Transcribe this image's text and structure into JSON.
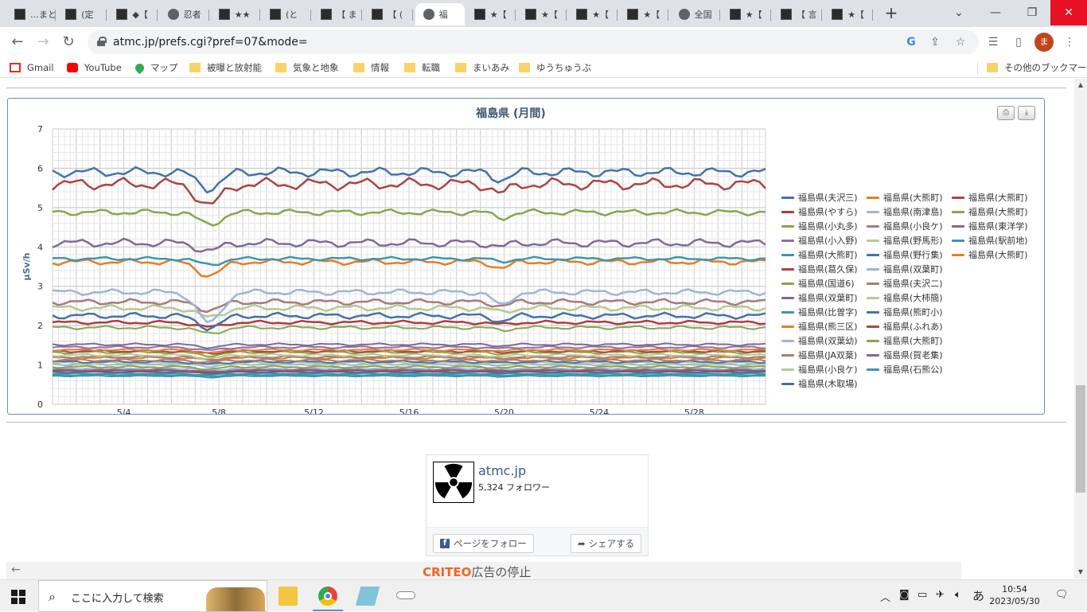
{
  "browser": {
    "tabs": [
      {
        "label": "…まと",
        "icon": "dark"
      },
      {
        "label": "(定",
        "icon": "dark"
      },
      {
        "label": "◆【",
        "icon": "dark"
      },
      {
        "label": "忍者",
        "icon": "globe"
      },
      {
        "label": "★★",
        "icon": "dark"
      },
      {
        "label": "(と",
        "icon": "dark"
      },
      {
        "label": "【 ま",
        "icon": "dark"
      },
      {
        "label": "【 (",
        "icon": "dark"
      },
      {
        "label": "福",
        "icon": "globe",
        "active": true
      },
      {
        "label": "★【",
        "icon": "dark"
      },
      {
        "label": "★【",
        "icon": "dark"
      },
      {
        "label": "★【",
        "icon": "dark"
      },
      {
        "label": "★【",
        "icon": "dark"
      },
      {
        "label": "全国",
        "icon": "globe"
      },
      {
        "label": "★【",
        "icon": "dark"
      },
      {
        "label": "【 言",
        "icon": "dark"
      },
      {
        "label": "★【",
        "icon": "dark"
      }
    ],
    "url": "atmc.jp/prefs.cgi?pref=07&mode=",
    "profile_initial": "ま",
    "bookmarks": [
      {
        "label": "Gmail",
        "icon": "gmail"
      },
      {
        "label": "YouTube",
        "icon": "yt"
      },
      {
        "label": "マップ",
        "icon": "maps"
      },
      {
        "label": "被曝と放射能",
        "icon": "folder"
      },
      {
        "label": "気象と地象",
        "icon": "folder"
      },
      {
        "label": "情報",
        "icon": "folder"
      },
      {
        "label": "転職",
        "icon": "folder"
      },
      {
        "label": "まいあみ",
        "icon": "folder"
      },
      {
        "label": "ゆうちゅうぶ",
        "icon": "folder"
      }
    ],
    "other_bookmarks": "その他のブックマーク"
  },
  "chart": {
    "title": "福島県 (月間)"
  },
  "chart_data": {
    "type": "line",
    "title": "福島県 (月間)",
    "ylabel": "μSv/h",
    "xlabel": "",
    "ylim": [
      0,
      7
    ],
    "yticks": [
      0,
      1,
      2,
      3,
      4,
      5,
      6,
      7
    ],
    "xlim": [
      1,
      31
    ],
    "xticks": [
      "5/4",
      "5/8",
      "5/12",
      "5/16",
      "5/20",
      "5/24",
      "5/28"
    ],
    "xtick_days": [
      4,
      8,
      12,
      16,
      20,
      24,
      28
    ],
    "grid": true,
    "legend_position": "right",
    "series": [
      {
        "name": "福島県(夫沢三)",
        "color": "#4572a7",
        "level": 5.9,
        "dip": 0.4,
        "amp": 0.08
      },
      {
        "name": "福島県(大熊町)",
        "color": "#e67e22",
        "level": 3.62,
        "dip": 0.35,
        "amp": 0.05
      },
      {
        "name": "福島県(大熊町)",
        "color": "#aa4643",
        "level": 5.6,
        "dip": 0.55,
        "amp": 0.1
      },
      {
        "name": "福島県(やすら)",
        "color": "#b23a3a",
        "level": 2.08,
        "dip": 0.12,
        "amp": 0.03
      },
      {
        "name": "福島県(南津島)",
        "color": "#9fb4d9",
        "level": 0.92,
        "dip": 0.05,
        "amp": 0.02
      },
      {
        "name": "福島県(大熊町)",
        "color": "#89a54e",
        "level": 4.88,
        "dip": 0.3,
        "amp": 0.05
      },
      {
        "name": "福島県(小丸多)",
        "color": "#89a54e",
        "level": 1.32,
        "dip": 0.08,
        "amp": 0.02
      },
      {
        "name": "福島県(小良ケ)",
        "color": "#a47d7c",
        "level": 2.6,
        "dip": 0.2,
        "amp": 0.05
      },
      {
        "name": "福島県(東洋学)",
        "color": "#80699b",
        "level": 4.1,
        "dip": 0.2,
        "amp": 0.07
      },
      {
        "name": "福島県(小入野)",
        "color": "#8e6fa8",
        "level": 1.45,
        "dip": 0.08,
        "amp": 0.02
      },
      {
        "name": "福島県(野馬形)",
        "color": "#b5ca92",
        "level": 2.45,
        "dip": 0.25,
        "amp": 0.05
      },
      {
        "name": "福島県(駅前地)",
        "color": "#3d96ae",
        "level": 3.7,
        "dip": 0.15,
        "amp": 0.03
      },
      {
        "name": "福島県(大熊町)",
        "color": "#3d96ae",
        "level": 0.72,
        "dip": 0.03,
        "amp": 0.01
      },
      {
        "name": "福島県(野行集)",
        "color": "#4572a7",
        "level": 2.25,
        "dip": 0.3,
        "amp": 0.05
      },
      {
        "name": "福島県(大熊町)",
        "color": "#e67e22",
        "level": 1.38,
        "dip": 0.07,
        "amp": 0.02
      },
      {
        "name": "福島県(葛久保)",
        "color": "#aa4643",
        "level": 0.85,
        "dip": 0.04,
        "amp": 0.01
      },
      {
        "name": "福島県(双葉町)",
        "color": "#9fb4d9",
        "level": 2.85,
        "dip": 0.8,
        "amp": 0.05
      },
      {
        "name": "福島県(国道6)",
        "color": "#89a54e",
        "level": 1.95,
        "dip": 0.15,
        "amp": 0.03
      },
      {
        "name": "福島県(夫沢二)",
        "color": "#a47d7c",
        "level": 1.2,
        "dip": 0.06,
        "amp": 0.02
      },
      {
        "name": "福島県(双葉町)",
        "color": "#80699b",
        "level": 1.52,
        "dip": 0.07,
        "amp": 0.02
      },
      {
        "name": "福島県(大柿簡)",
        "color": "#b5ca92",
        "level": 1.25,
        "dip": 0.08,
        "amp": 0.02
      },
      {
        "name": "福島県(比曽字)",
        "color": "#3d96ae",
        "level": 0.78,
        "dip": 0.03,
        "amp": 0.01
      },
      {
        "name": "福島県(熊町小)",
        "color": "#4572a7",
        "level": 1.08,
        "dip": 0.06,
        "amp": 0.02
      },
      {
        "name": "福島県(熊三区)",
        "color": "#e67e22",
        "level": 1.18,
        "dip": 0.05,
        "amp": 0.02
      },
      {
        "name": "福島県(ふれあ)",
        "color": "#aa4643",
        "level": 1.35,
        "dip": 0.05,
        "amp": 0.02
      },
      {
        "name": "福島県(双葉幼)",
        "color": "#9fb4d9",
        "level": 1.02,
        "dip": 0.05,
        "amp": 0.02
      },
      {
        "name": "福島県(大熊町)",
        "color": "#89a54e",
        "level": 0.95,
        "dip": 0.05,
        "amp": 0.02
      },
      {
        "name": "福島県(JA双葉)",
        "color": "#a47d7c",
        "level": 1.12,
        "dip": 0.05,
        "amp": 0.02
      },
      {
        "name": "福島県(賀老集)",
        "color": "#80699b",
        "level": 0.88,
        "dip": 0.04,
        "amp": 0.01
      },
      {
        "name": "福島県(小良ケ)",
        "color": "#b5ca92",
        "level": 1.05,
        "dip": 0.05,
        "amp": 0.02
      },
      {
        "name": "福島県(石熊公)",
        "color": "#3d96ae",
        "level": 0.75,
        "dip": 0.03,
        "amp": 0.01
      },
      {
        "name": "福島県(木取場)",
        "color": "#4572a7",
        "level": 0.82,
        "dip": 0.03,
        "amp": 0.01
      }
    ]
  },
  "facebook": {
    "page_name": "atmc.jp",
    "followers": "5,324 フォロワー",
    "follow_label": "ページをフォロー",
    "share_label": "シェアする"
  },
  "ad": {
    "brand": "CRITEO",
    "text": "広告の停止"
  },
  "taskbar": {
    "search_placeholder": "ここに入力して検索",
    "ime": "あ",
    "time": "10:54",
    "date": "2023/05/30"
  },
  "colors": {
    "tabstrip": "#dee1e6",
    "close_button": "#e81123",
    "chart_border": "#6b8fb3",
    "chart_title": "#3e576f"
  }
}
